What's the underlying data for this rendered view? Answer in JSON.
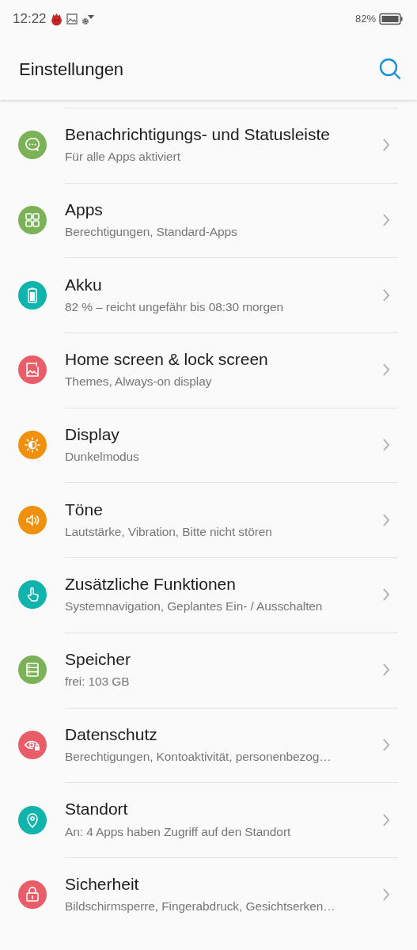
{
  "status_bar": {
    "time": "12:22",
    "battery_text": "82%"
  },
  "header": {
    "title": "Einstellungen"
  },
  "items": [
    {
      "title": "Benachrichtigungs- und Statusleiste",
      "subtitle": "Für alle Apps aktiviert",
      "color": "#7bb157"
    },
    {
      "title": "Apps",
      "subtitle": "Berechtigungen, Standard-Apps",
      "color": "#7bb157"
    },
    {
      "title": "Akku",
      "subtitle": "82 % – reicht ungefähr bis 08:30 morgen",
      "color": "#10b4ad"
    },
    {
      "title": "Home screen & lock screen",
      "subtitle": "Themes, Always-on display",
      "color": "#e85d68"
    },
    {
      "title": "Display",
      "subtitle": "Dunkelmodus",
      "color": "#f0910e"
    },
    {
      "title": "Töne",
      "subtitle": "Lautstärke, Vibration, Bitte nicht stören",
      "color": "#f0910e"
    },
    {
      "title": "Zusätzliche Funktionen",
      "subtitle": "Systemnavigation, Geplantes Ein- / Ausschalten",
      "color": "#10b4ad"
    },
    {
      "title": "Speicher",
      "subtitle": "frei: 103 GB",
      "color": "#7bb157"
    },
    {
      "title": "Datenschutz",
      "subtitle": "Berechtigungen, Kontoaktivität, personenbezog…",
      "color": "#e85d68"
    },
    {
      "title": "Standort",
      "subtitle": "An: 4 Apps haben Zugriff auf den Standort",
      "color": "#10b4ad"
    },
    {
      "title": "Sicherheit",
      "subtitle": "Bildschirmsperre, Fingerabdruck, Gesichtserken…",
      "color": "#e85d68"
    }
  ]
}
